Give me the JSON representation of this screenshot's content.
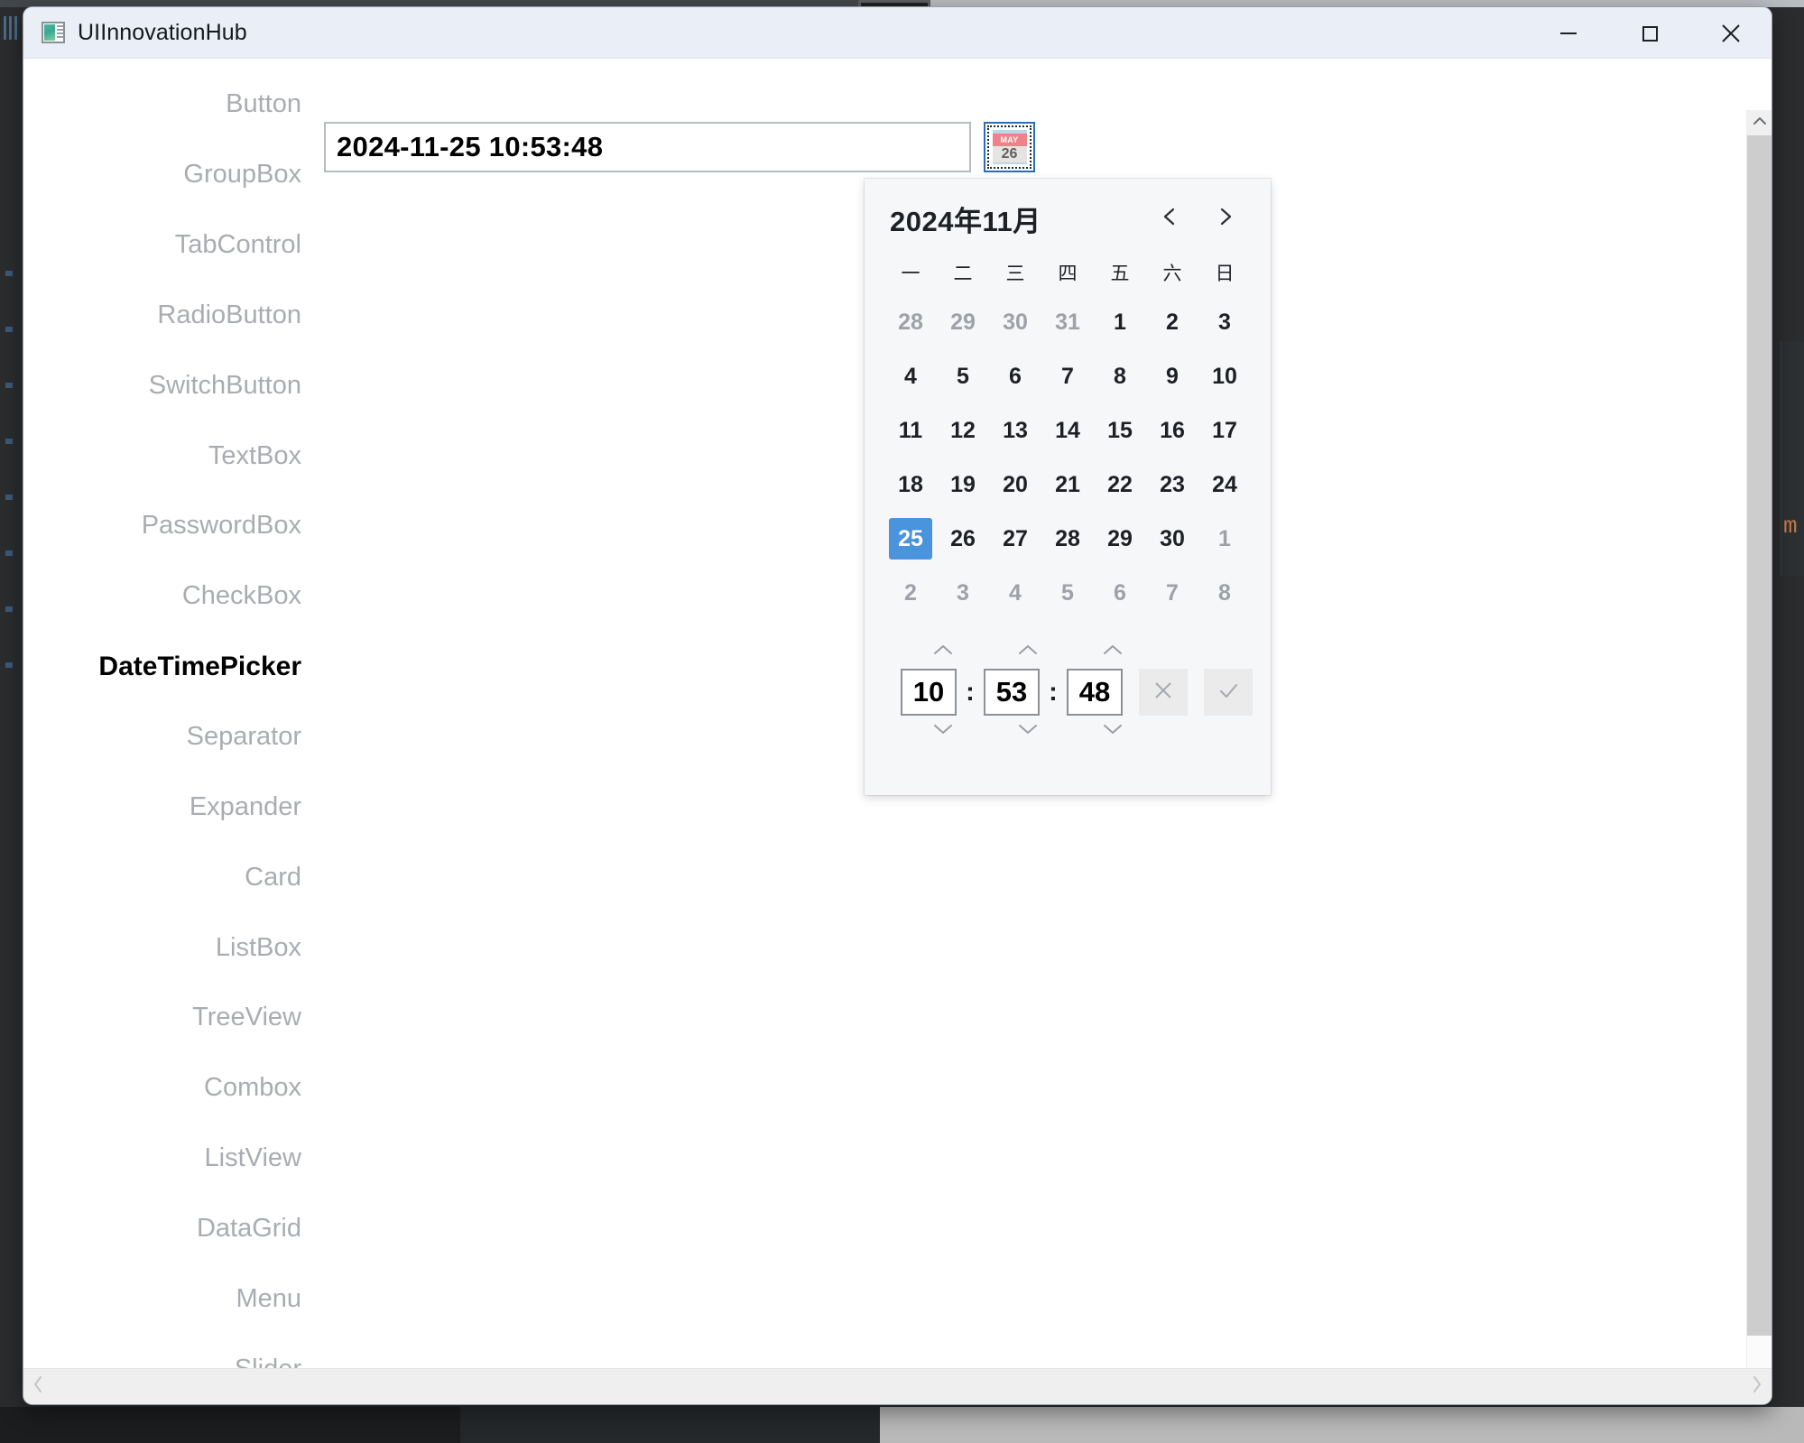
{
  "window": {
    "title": "UIInnovationHub",
    "app_icon": "app-window-icon",
    "controls": {
      "minimize": "minimize-icon",
      "maximize": "maximize-icon",
      "close": "close-icon"
    }
  },
  "sidebar": {
    "items": [
      {
        "label": "Button",
        "active": false
      },
      {
        "label": "GroupBox",
        "active": false
      },
      {
        "label": "TabControl",
        "active": false
      },
      {
        "label": "RadioButton",
        "active": false
      },
      {
        "label": "SwitchButton",
        "active": false
      },
      {
        "label": "TextBox",
        "active": false
      },
      {
        "label": "PasswordBox",
        "active": false
      },
      {
        "label": "CheckBox",
        "active": false
      },
      {
        "label": "DateTimePicker",
        "active": true
      },
      {
        "label": "Separator",
        "active": false
      },
      {
        "label": "Expander",
        "active": false
      },
      {
        "label": "Card",
        "active": false
      },
      {
        "label": "ListBox",
        "active": false
      },
      {
        "label": "TreeView",
        "active": false
      },
      {
        "label": "Combox",
        "active": false
      },
      {
        "label": "ListView",
        "active": false
      },
      {
        "label": "DataGrid",
        "active": false
      },
      {
        "label": "Menu",
        "active": false
      },
      {
        "label": "Slider",
        "active": false
      }
    ]
  },
  "datetime_picker": {
    "value": "2024-11-25 10:53:48",
    "placeholder": "",
    "button_icon": "calendar-icon",
    "icon_month_label": "MAY",
    "icon_day_label": "26",
    "accent_color": "#4a93dd",
    "icon_band_color": "#ef8289",
    "focus_border_color": "#2b6cb8"
  },
  "calendar_popup": {
    "title": "2024年11月",
    "prev_icon": "chevron-left-icon",
    "next_icon": "chevron-right-icon",
    "weekdays": [
      "一",
      "二",
      "三",
      "四",
      "五",
      "六",
      "日"
    ],
    "weeks": [
      [
        {
          "d": "28",
          "mute": true,
          "sel": false
        },
        {
          "d": "29",
          "mute": true,
          "sel": false
        },
        {
          "d": "30",
          "mute": true,
          "sel": false
        },
        {
          "d": "31",
          "mute": true,
          "sel": false
        },
        {
          "d": "1",
          "mute": false,
          "sel": false
        },
        {
          "d": "2",
          "mute": false,
          "sel": false
        },
        {
          "d": "3",
          "mute": false,
          "sel": false
        }
      ],
      [
        {
          "d": "4",
          "mute": false,
          "sel": false
        },
        {
          "d": "5",
          "mute": false,
          "sel": false
        },
        {
          "d": "6",
          "mute": false,
          "sel": false
        },
        {
          "d": "7",
          "mute": false,
          "sel": false
        },
        {
          "d": "8",
          "mute": false,
          "sel": false
        },
        {
          "d": "9",
          "mute": false,
          "sel": false
        },
        {
          "d": "10",
          "mute": false,
          "sel": false
        }
      ],
      [
        {
          "d": "11",
          "mute": false,
          "sel": false
        },
        {
          "d": "12",
          "mute": false,
          "sel": false
        },
        {
          "d": "13",
          "mute": false,
          "sel": false
        },
        {
          "d": "14",
          "mute": false,
          "sel": false
        },
        {
          "d": "15",
          "mute": false,
          "sel": false
        },
        {
          "d": "16",
          "mute": false,
          "sel": false
        },
        {
          "d": "17",
          "mute": false,
          "sel": false
        }
      ],
      [
        {
          "d": "18",
          "mute": false,
          "sel": false
        },
        {
          "d": "19",
          "mute": false,
          "sel": false
        },
        {
          "d": "20",
          "mute": false,
          "sel": false
        },
        {
          "d": "21",
          "mute": false,
          "sel": false
        },
        {
          "d": "22",
          "mute": false,
          "sel": false
        },
        {
          "d": "23",
          "mute": false,
          "sel": false
        },
        {
          "d": "24",
          "mute": false,
          "sel": false
        }
      ],
      [
        {
          "d": "25",
          "mute": false,
          "sel": true
        },
        {
          "d": "26",
          "mute": false,
          "sel": false
        },
        {
          "d": "27",
          "mute": false,
          "sel": false
        },
        {
          "d": "28",
          "mute": false,
          "sel": false
        },
        {
          "d": "29",
          "mute": false,
          "sel": false
        },
        {
          "d": "30",
          "mute": false,
          "sel": false
        },
        {
          "d": "1",
          "mute": true,
          "sel": false
        }
      ],
      [
        {
          "d": "2",
          "mute": true,
          "sel": false
        },
        {
          "d": "3",
          "mute": true,
          "sel": false
        },
        {
          "d": "4",
          "mute": true,
          "sel": false
        },
        {
          "d": "5",
          "mute": true,
          "sel": false
        },
        {
          "d": "6",
          "mute": true,
          "sel": false
        },
        {
          "d": "7",
          "mute": true,
          "sel": false
        },
        {
          "d": "8",
          "mute": true,
          "sel": false
        }
      ]
    ],
    "time": {
      "hour": "10",
      "minute": "53",
      "second": "48",
      "separator": ":",
      "up_icon": "chevron-up-icon",
      "down_icon": "chevron-down-icon",
      "cancel_icon": "close-x-icon",
      "confirm_icon": "check-icon"
    }
  },
  "scrollbars": {
    "vertical": {
      "up_icon": "scroll-up-icon",
      "down_icon": "scroll-down-icon"
    },
    "horizontal": {
      "left_icon": "scroll-left-icon",
      "right_icon": "scroll-right-icon"
    }
  }
}
